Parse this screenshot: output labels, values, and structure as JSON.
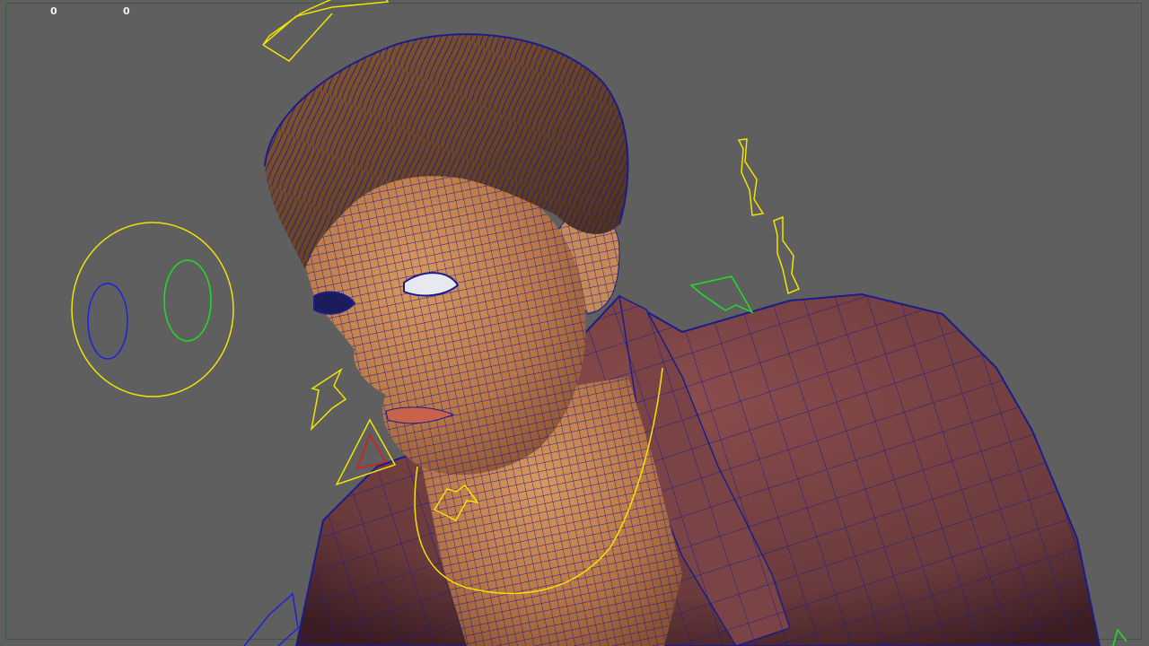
{
  "viewport": {
    "hud_values": [
      "0",
      "0"
    ]
  },
  "colors": {
    "background": "#5f5f5f",
    "control_yellow": "#f2e300",
    "control_green": "#22dd22",
    "control_blue": "#2020e0",
    "control_red": "#e01818",
    "wireframe": "#1c1c8c",
    "skin": "#c0804f",
    "shirt": "#6a3a3c",
    "hair": "#6a4424"
  }
}
